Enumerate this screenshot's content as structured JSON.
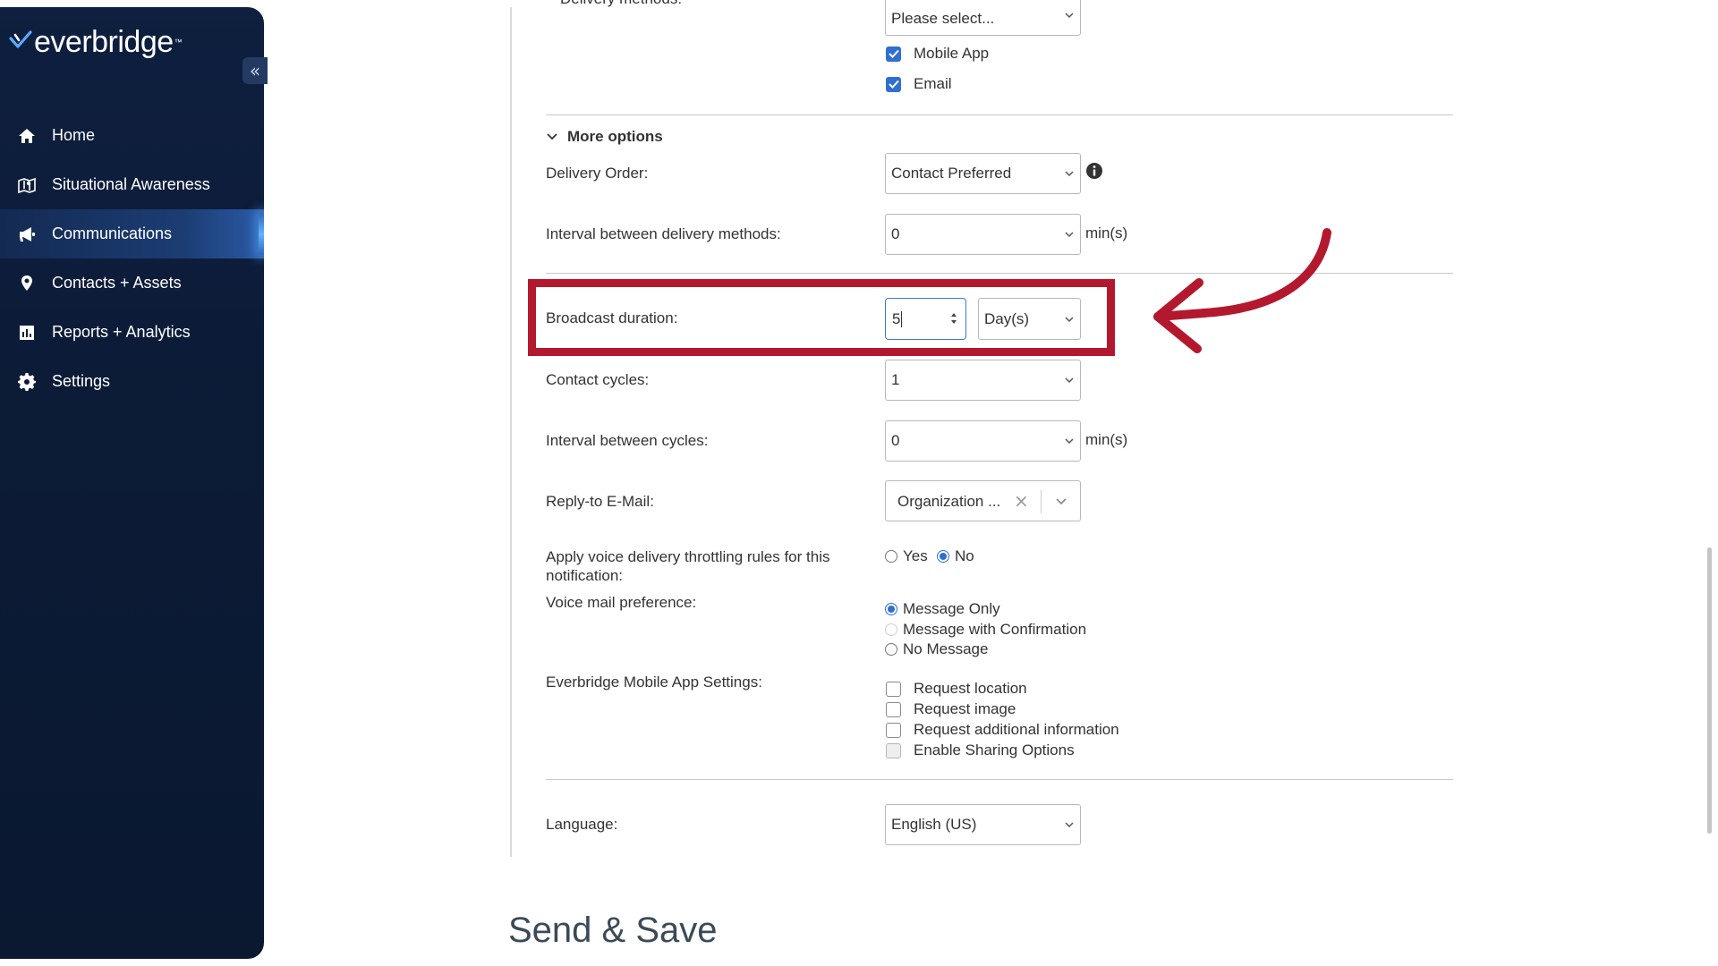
{
  "brand": {
    "name": "everbridge",
    "tm": "™"
  },
  "sidebar": {
    "collapse_icon": "«",
    "items": [
      {
        "label": "Home",
        "icon": "home-icon"
      },
      {
        "label": "Situational Awareness",
        "icon": "map-icon"
      },
      {
        "label": "Communications",
        "icon": "megaphone-icon",
        "active": true
      },
      {
        "label": "Contacts + Assets",
        "icon": "location-pin-icon"
      },
      {
        "label": "Reports + Analytics",
        "icon": "bar-chart-icon"
      },
      {
        "label": "Settings",
        "icon": "gear-icon"
      }
    ]
  },
  "form": {
    "delivery_methods": {
      "label": "Delivery methods:",
      "select_placeholder": "Please select...",
      "options": [
        {
          "label": "Mobile App",
          "checked": true
        },
        {
          "label": "Email",
          "checked": true
        }
      ]
    },
    "more_options_label": "More options",
    "delivery_order": {
      "label": "Delivery Order:",
      "value": "Contact Preferred"
    },
    "interval_delivery": {
      "label": "Interval between delivery methods:",
      "value": "0",
      "unit": "min(s)"
    },
    "broadcast_duration": {
      "label": "Broadcast duration:",
      "value": "5",
      "unit_value": "Day(s)"
    },
    "contact_cycles": {
      "label": "Contact cycles:",
      "value": "1"
    },
    "interval_cycles": {
      "label": "Interval between cycles:",
      "value": "0",
      "unit": "min(s)"
    },
    "reply_to": {
      "label": "Reply-to E-Mail:",
      "value": "Organization ..."
    },
    "voice_throttling": {
      "label_line1": "Apply voice delivery throttling rules for this",
      "label_line2": "notification:",
      "yes": "Yes",
      "no": "No",
      "selected": "No"
    },
    "voice_mail": {
      "label": "Voice mail preference:",
      "options": [
        "Message Only",
        "Message with Confirmation",
        "No Message"
      ],
      "selected": "Message Only"
    },
    "mobile_app_settings": {
      "label": "Everbridge Mobile App Settings:",
      "options": [
        "Request location",
        "Request image",
        "Request additional information",
        "Enable Sharing Options"
      ]
    },
    "language": {
      "label": "Language:",
      "value": "English (US)"
    }
  },
  "section_title": "Send & Save",
  "colors": {
    "highlight": "#b3192e",
    "accent": "#2f6fd1",
    "sidebar_bg": "#0c1b36"
  }
}
